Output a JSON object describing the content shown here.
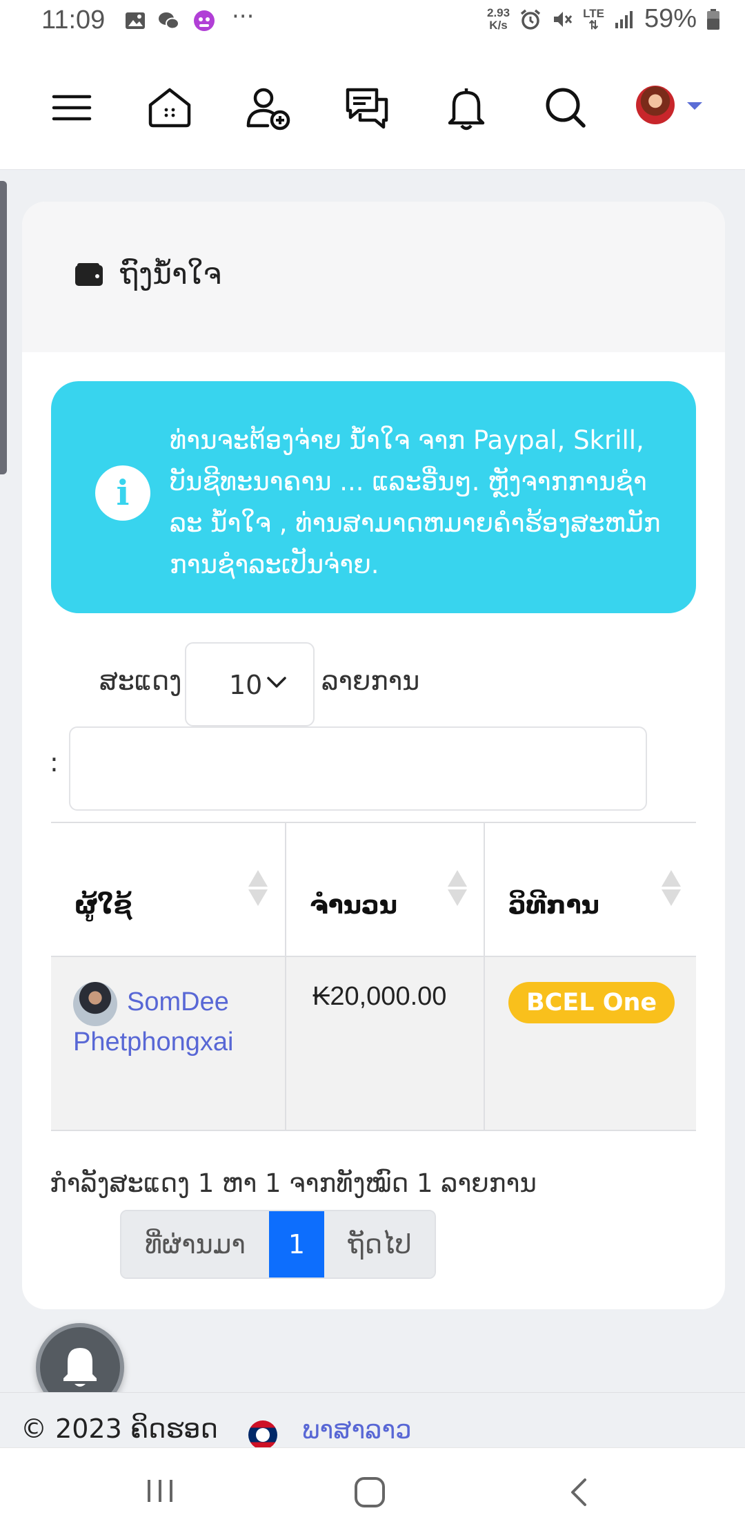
{
  "status_bar": {
    "time": "11:09",
    "more": "···",
    "net_speed_value": "2.93",
    "net_speed_unit": "K/s",
    "network": "LTE",
    "battery": "59%"
  },
  "nav": {
    "icons": [
      "menu-icon",
      "home-icon",
      "add-user-icon",
      "messages-icon",
      "bell-icon",
      "search-icon"
    ],
    "accent": "#5b6dd6"
  },
  "card": {
    "title": "ຖົງນ້ຳໃຈ",
    "info_text": "ທ່ານຈະຕ້ອງຈ່າຍ ນໍ້າໃຈ ຈາກ Paypal, Skrill, ບັນຊີທະນາຄານ ... ແລະອື່ນໆ. ຫຼັງຈາກການຊໍາລະ ນໍ້າໃຈ , ທ່ານສາມາດຫມາຍຄໍາຮ້ອງສະຫມັກການຊໍາລະເປັນຈ່າຍ.",
    "info_color": "#38d4ee"
  },
  "table_controls": {
    "show_label": "ສະແດງ",
    "page_length": "10",
    "entries_label": "ລາຍການ",
    "search_label": ":",
    "search_value": ""
  },
  "table": {
    "headers": [
      "ຜູ້ໃຊ້",
      "ຈໍານວນ",
      "ວິທີການ"
    ],
    "rows": [
      {
        "user": "SomDee Phetphongxai",
        "amount": "₭20,000.00",
        "method": "BCEL One"
      }
    ],
    "badge_color": "#f9c01c"
  },
  "pagination": {
    "showing": "ກໍາລັງສະແດງ 1 ຫາ 1 ຈາກທັງໝົດ 1 ລາຍການ",
    "prev": "ທີ່ຜ່ານມາ",
    "current": "1",
    "next": "ຖັດໄປ",
    "active_color": "#0d6efd"
  },
  "footer": {
    "copyright": "© 2023 ຄິດຮອດ",
    "language": "ພາສາລາວ"
  }
}
